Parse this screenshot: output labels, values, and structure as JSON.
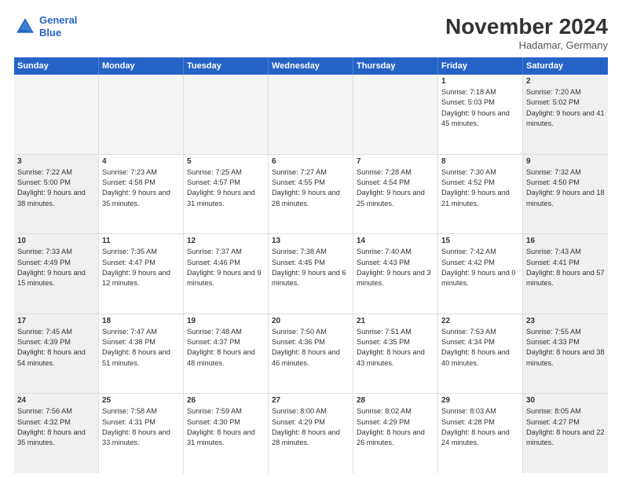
{
  "logo": {
    "line1": "General",
    "line2": "Blue"
  },
  "title": "November 2024",
  "location": "Hadamar, Germany",
  "days_of_week": [
    "Sunday",
    "Monday",
    "Tuesday",
    "Wednesday",
    "Thursday",
    "Friday",
    "Saturday"
  ],
  "weeks": [
    [
      {
        "day": "",
        "empty": true
      },
      {
        "day": "",
        "empty": true
      },
      {
        "day": "",
        "empty": true
      },
      {
        "day": "",
        "empty": true
      },
      {
        "day": "",
        "empty": true
      },
      {
        "day": "1",
        "detail": "Sunrise: 7:18 AM\nSunset: 5:03 PM\nDaylight: 9 hours and 45 minutes."
      },
      {
        "day": "2",
        "detail": "Sunrise: 7:20 AM\nSunset: 5:02 PM\nDaylight: 9 hours and 41 minutes."
      }
    ],
    [
      {
        "day": "3",
        "detail": "Sunrise: 7:22 AM\nSunset: 5:00 PM\nDaylight: 9 hours and 38 minutes."
      },
      {
        "day": "4",
        "detail": "Sunrise: 7:23 AM\nSunset: 4:58 PM\nDaylight: 9 hours and 35 minutes."
      },
      {
        "day": "5",
        "detail": "Sunrise: 7:25 AM\nSunset: 4:57 PM\nDaylight: 9 hours and 31 minutes."
      },
      {
        "day": "6",
        "detail": "Sunrise: 7:27 AM\nSunset: 4:55 PM\nDaylight: 9 hours and 28 minutes."
      },
      {
        "day": "7",
        "detail": "Sunrise: 7:28 AM\nSunset: 4:54 PM\nDaylight: 9 hours and 25 minutes."
      },
      {
        "day": "8",
        "detail": "Sunrise: 7:30 AM\nSunset: 4:52 PM\nDaylight: 9 hours and 21 minutes."
      },
      {
        "day": "9",
        "detail": "Sunrise: 7:32 AM\nSunset: 4:50 PM\nDaylight: 9 hours and 18 minutes."
      }
    ],
    [
      {
        "day": "10",
        "detail": "Sunrise: 7:33 AM\nSunset: 4:49 PM\nDaylight: 9 hours and 15 minutes."
      },
      {
        "day": "11",
        "detail": "Sunrise: 7:35 AM\nSunset: 4:47 PM\nDaylight: 9 hours and 12 minutes."
      },
      {
        "day": "12",
        "detail": "Sunrise: 7:37 AM\nSunset: 4:46 PM\nDaylight: 9 hours and 9 minutes."
      },
      {
        "day": "13",
        "detail": "Sunrise: 7:38 AM\nSunset: 4:45 PM\nDaylight: 9 hours and 6 minutes."
      },
      {
        "day": "14",
        "detail": "Sunrise: 7:40 AM\nSunset: 4:43 PM\nDaylight: 9 hours and 3 minutes."
      },
      {
        "day": "15",
        "detail": "Sunrise: 7:42 AM\nSunset: 4:42 PM\nDaylight: 9 hours and 0 minutes."
      },
      {
        "day": "16",
        "detail": "Sunrise: 7:43 AM\nSunset: 4:41 PM\nDaylight: 8 hours and 57 minutes."
      }
    ],
    [
      {
        "day": "17",
        "detail": "Sunrise: 7:45 AM\nSunset: 4:39 PM\nDaylight: 8 hours and 54 minutes."
      },
      {
        "day": "18",
        "detail": "Sunrise: 7:47 AM\nSunset: 4:38 PM\nDaylight: 8 hours and 51 minutes."
      },
      {
        "day": "19",
        "detail": "Sunrise: 7:48 AM\nSunset: 4:37 PM\nDaylight: 8 hours and 48 minutes."
      },
      {
        "day": "20",
        "detail": "Sunrise: 7:50 AM\nSunset: 4:36 PM\nDaylight: 8 hours and 46 minutes."
      },
      {
        "day": "21",
        "detail": "Sunrise: 7:51 AM\nSunset: 4:35 PM\nDaylight: 8 hours and 43 minutes."
      },
      {
        "day": "22",
        "detail": "Sunrise: 7:53 AM\nSunset: 4:34 PM\nDaylight: 8 hours and 40 minutes."
      },
      {
        "day": "23",
        "detail": "Sunrise: 7:55 AM\nSunset: 4:33 PM\nDaylight: 8 hours and 38 minutes."
      }
    ],
    [
      {
        "day": "24",
        "detail": "Sunrise: 7:56 AM\nSunset: 4:32 PM\nDaylight: 8 hours and 35 minutes."
      },
      {
        "day": "25",
        "detail": "Sunrise: 7:58 AM\nSunset: 4:31 PM\nDaylight: 8 hours and 33 minutes."
      },
      {
        "day": "26",
        "detail": "Sunrise: 7:59 AM\nSunset: 4:30 PM\nDaylight: 8 hours and 31 minutes."
      },
      {
        "day": "27",
        "detail": "Sunrise: 8:00 AM\nSunset: 4:29 PM\nDaylight: 8 hours and 28 minutes."
      },
      {
        "day": "28",
        "detail": "Sunrise: 8:02 AM\nSunset: 4:29 PM\nDaylight: 8 hours and 26 minutes."
      },
      {
        "day": "29",
        "detail": "Sunrise: 8:03 AM\nSunset: 4:28 PM\nDaylight: 8 hours and 24 minutes."
      },
      {
        "day": "30",
        "detail": "Sunrise: 8:05 AM\nSunset: 4:27 PM\nDaylight: 8 hours and 22 minutes."
      }
    ]
  ]
}
